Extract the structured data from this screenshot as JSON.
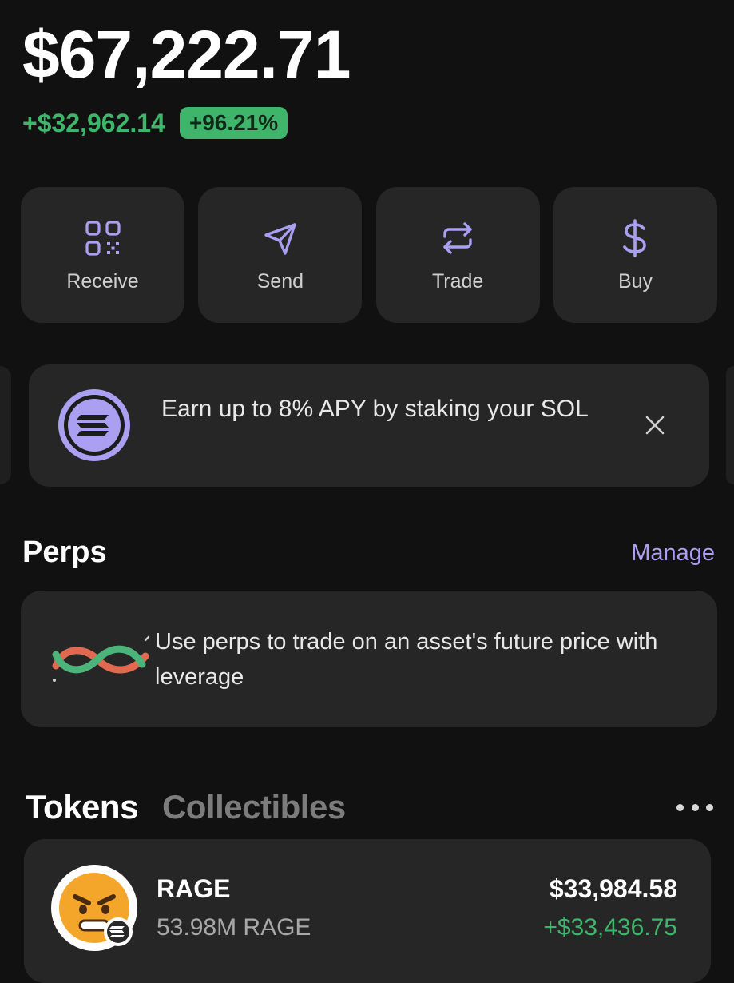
{
  "portfolio": {
    "balance": "$67,222.71",
    "change_amount": "+$32,962.14",
    "change_percent": "+96.21%"
  },
  "actions": [
    {
      "label": "Receive",
      "icon": "qr-code-icon"
    },
    {
      "label": "Send",
      "icon": "send-icon"
    },
    {
      "label": "Trade",
      "icon": "swap-icon"
    },
    {
      "label": "Buy",
      "icon": "dollar-icon"
    }
  ],
  "promo": {
    "text": "Earn up to 8% APY by staking your SOL",
    "icon": "solana-icon",
    "close_icon": "close-icon"
  },
  "perps": {
    "title": "Perps",
    "manage_label": "Manage",
    "description": "Use perps to trade on an asset's future price with leverage",
    "icon": "perps-infinity-icon"
  },
  "assets": {
    "tabs": [
      {
        "label": "Tokens",
        "active": true
      },
      {
        "label": "Collectibles",
        "active": false
      }
    ],
    "more_icon": "more-dots-icon",
    "tokens": [
      {
        "name": "RAGE",
        "amount": "53.98M RAGE",
        "value": "$33,984.58",
        "change": "+$33,436.75",
        "icon": "angry-emoji-icon"
      }
    ]
  },
  "colors": {
    "background": "#111111",
    "card": "#262626",
    "accent_purple": "#ab9ff2",
    "positive_green": "#3fb56b"
  }
}
